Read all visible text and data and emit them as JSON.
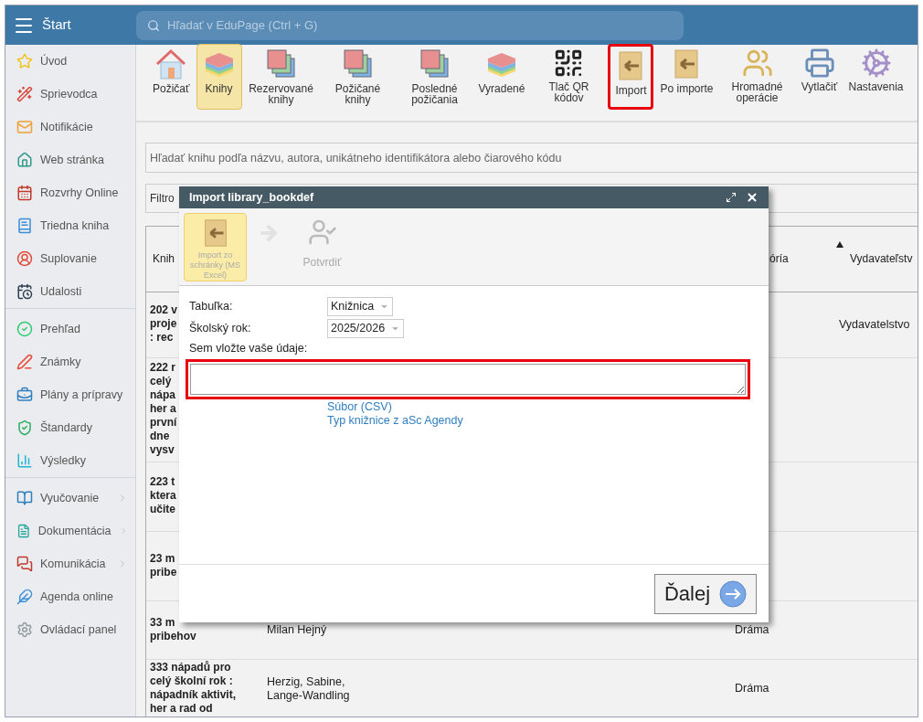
{
  "topbar": {
    "title": "Štart",
    "search": {
      "placeholder": "Hľadať v EduPage (Ctrl + G)"
    }
  },
  "sidebar": {
    "groups": [
      {
        "items": [
          {
            "label": "Úvod",
            "submenu": false
          },
          {
            "label": "Sprievodca",
            "submenu": false
          },
          {
            "label": "Notifikácie",
            "submenu": false
          },
          {
            "label": "Web stránka",
            "submenu": false
          },
          {
            "label": "Rozvrhy Online",
            "submenu": false
          },
          {
            "label": "Triedna kniha",
            "submenu": false
          },
          {
            "label": "Suplovanie",
            "submenu": false
          },
          {
            "label": "Udalosti",
            "submenu": false
          }
        ]
      },
      {
        "items": [
          {
            "label": "Prehľad",
            "submenu": false
          },
          {
            "label": "Známky",
            "submenu": false
          },
          {
            "label": "Plány a prípravy",
            "submenu": false
          },
          {
            "label": "Štandardy",
            "submenu": false
          },
          {
            "label": "Výsledky",
            "submenu": false
          }
        ]
      },
      {
        "items": [
          {
            "label": "Vyučovanie",
            "submenu": true
          },
          {
            "label": "Dokumentácia",
            "submenu": true
          },
          {
            "label": "Komunikácia",
            "submenu": true
          },
          {
            "label": "Agenda online",
            "submenu": false
          },
          {
            "label": "Ovládací panel",
            "submenu": false
          }
        ]
      }
    ]
  },
  "toolbar": {
    "items": [
      {
        "label": "Požičať",
        "selected": false,
        "highlighted": false
      },
      {
        "label": "Knihy",
        "selected": true,
        "highlighted": false
      },
      {
        "label": "Rezervované knihy",
        "selected": false,
        "highlighted": false
      },
      {
        "label": "Požičané knihy",
        "selected": false,
        "highlighted": false
      },
      {
        "label": "Posledné požičania",
        "selected": false,
        "highlighted": false
      },
      {
        "label": "Vyradené",
        "selected": false,
        "highlighted": false
      },
      {
        "label": "Tlač QR kódov",
        "selected": false,
        "highlighted": false
      },
      {
        "label": "Import",
        "selected": false,
        "highlighted": true
      },
      {
        "label": "Po importe",
        "selected": false,
        "highlighted": false
      },
      {
        "label": "Hromadné operácie",
        "selected": false,
        "highlighted": false
      },
      {
        "label": "Vytlačiť",
        "selected": false,
        "highlighted": false
      },
      {
        "label": "Nastavenia",
        "selected": false,
        "highlighted": false
      }
    ]
  },
  "book_search": {
    "placeholder": "Hľadať knihu podľa názvu, autora, unikátneho identifikátora alebo čiarového kódu"
  },
  "filter": {
    "label": "Filtro"
  },
  "table": {
    "columns": [
      {
        "label": "Knih"
      },
      {
        "label": "óría"
      },
      {
        "label": "Vydavateľstv",
        "sorted": true
      }
    ],
    "rows": [
      {
        "column_1": "202 v\nproje\n: rec",
        "column_4": "Vydavatelstvo"
      },
      {
        "column_1": "222 r\ncelý\nnápa\nher a\nprvní\ndne\nvysv"
      },
      {
        "column_1": "223 t\nktera\nučite"
      },
      {
        "column_1": "23 m\npribe"
      },
      {
        "column_1": "33 m\npribehov",
        "column_2": "Milan Hejný",
        "column_3": "Dráma"
      },
      {
        "column_1": "333 nápadů pro\ncelý školní rok :\nnápadník aktivit,\nher a rad od",
        "column_2": "Herzig, Sabine,\nLange-Wandling",
        "column_3": "Dráma"
      }
    ]
  },
  "dialog": {
    "title": "Import library_bookdef",
    "steps": [
      {
        "label": "Import zo schránky (MS Excel)",
        "selected": true
      },
      {
        "label": "Potvrdiť",
        "selected": false
      }
    ],
    "fields": [
      {
        "label": "Tabuľka:",
        "value": "Knižnica"
      },
      {
        "label": "Školský rok:",
        "value": "2025/2026"
      }
    ],
    "paste": {
      "label": "Sem vložte vaše údaje:",
      "highlighted": true
    },
    "links": [
      "Súbor (CSV)",
      "Typ knižnice z aSc Agendy"
    ],
    "next_button": "Ďalej"
  }
}
